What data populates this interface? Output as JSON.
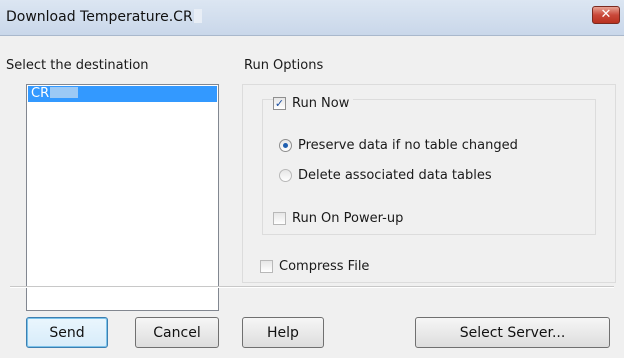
{
  "window": {
    "title": "Download Temperature.CR",
    "close_glyph": "✕"
  },
  "destination": {
    "label": "Select the destination",
    "items": [
      "CR"
    ]
  },
  "run_options": {
    "label": "Run Options",
    "run_now": {
      "label": "Run Now",
      "checked": true
    },
    "preserve": {
      "label": "Preserve data if no table changed",
      "selected": true
    },
    "delete": {
      "label": "Delete associated data tables",
      "selected": false
    },
    "power_up": {
      "label": "Run On Power-up",
      "checked": false
    }
  },
  "compress": {
    "label": "Compress File",
    "checked": false
  },
  "buttons": {
    "send": "Send",
    "cancel": "Cancel",
    "help": "Help",
    "select_server": "Select Server..."
  },
  "colors": {
    "selection": "#3399ff",
    "title_gradient_top": "#dce6f2",
    "close_red": "#c9483a"
  }
}
